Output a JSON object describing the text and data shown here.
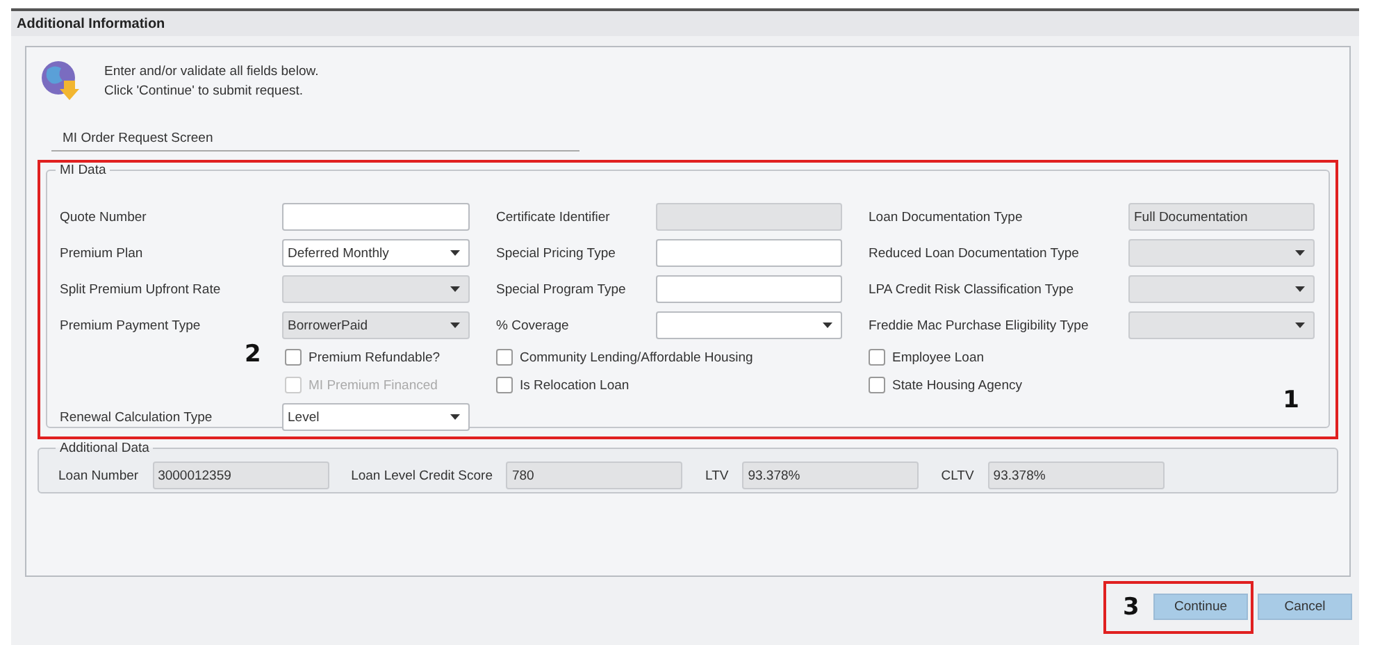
{
  "window": {
    "title": "Additional Information"
  },
  "header": {
    "lines": [
      "Enter and/or validate all fields below.",
      "Click 'Continue' to submit request."
    ]
  },
  "section_tab": "MI Order Request Screen",
  "mi_data": {
    "legend": "MI Data",
    "columns": [
      {
        "items": [
          {
            "kind": "text",
            "label": "Quote Number",
            "value": "",
            "disabled": false
          },
          {
            "kind": "select",
            "label": "Premium Plan",
            "value": "Deferred Monthly",
            "disabled": false
          },
          {
            "kind": "select",
            "label": "Split Premium Upfront Rate",
            "value": "",
            "disabled": true
          },
          {
            "kind": "select",
            "label": "Premium Payment Type",
            "value": "BorrowerPaid",
            "disabled": true
          },
          {
            "kind": "checkbox",
            "label": "Premium Refundable?",
            "checked": false,
            "disabled": false
          },
          {
            "kind": "checkbox",
            "label": "MI Premium Financed",
            "checked": false,
            "disabled": true
          },
          {
            "kind": "select",
            "label": "Renewal Calculation Type",
            "value": "Level",
            "disabled": false
          }
        ]
      },
      {
        "items": [
          {
            "kind": "text",
            "label": "Certificate Identifier",
            "value": "",
            "disabled": true
          },
          {
            "kind": "text",
            "label": "Special Pricing Type",
            "value": "",
            "disabled": false
          },
          {
            "kind": "text",
            "label": "Special Program Type",
            "value": "",
            "disabled": false
          },
          {
            "kind": "select",
            "label": "% Coverage",
            "value": "",
            "disabled": false
          },
          {
            "kind": "checkbox",
            "label": "Community Lending/Affordable Housing",
            "checked": false,
            "disabled": false
          },
          {
            "kind": "checkbox",
            "label": "Is Relocation Loan",
            "checked": false,
            "disabled": false
          }
        ]
      },
      {
        "items": [
          {
            "kind": "text",
            "label": "Loan Documentation Type",
            "value": "Full Documentation",
            "disabled": true
          },
          {
            "kind": "select",
            "label": "Reduced Loan Documentation Type",
            "value": "",
            "disabled": true
          },
          {
            "kind": "select",
            "label": "LPA Credit Risk Classification Type",
            "value": "",
            "disabled": true
          },
          {
            "kind": "select",
            "label": "Freddie Mac Purchase Eligibility Type",
            "value": "",
            "disabled": true
          },
          {
            "kind": "checkbox",
            "label": "Employee Loan",
            "checked": false,
            "disabled": false
          },
          {
            "kind": "checkbox",
            "label": "State Housing Agency",
            "checked": false,
            "disabled": false
          }
        ]
      }
    ]
  },
  "additional_data": {
    "legend": "Additional Data",
    "fields": [
      {
        "label": "Loan Number",
        "value": "3000012359"
      },
      {
        "label": "Loan Level Credit Score",
        "value": "780"
      },
      {
        "label": "LTV",
        "value": "93.378%"
      },
      {
        "label": "CLTV",
        "value": "93.378%"
      }
    ]
  },
  "buttons": [
    {
      "label": "Continue"
    },
    {
      "label": "Cancel"
    }
  ],
  "annotations": {
    "mi_data": "1",
    "checkboxes": "2",
    "continue": "3"
  }
}
